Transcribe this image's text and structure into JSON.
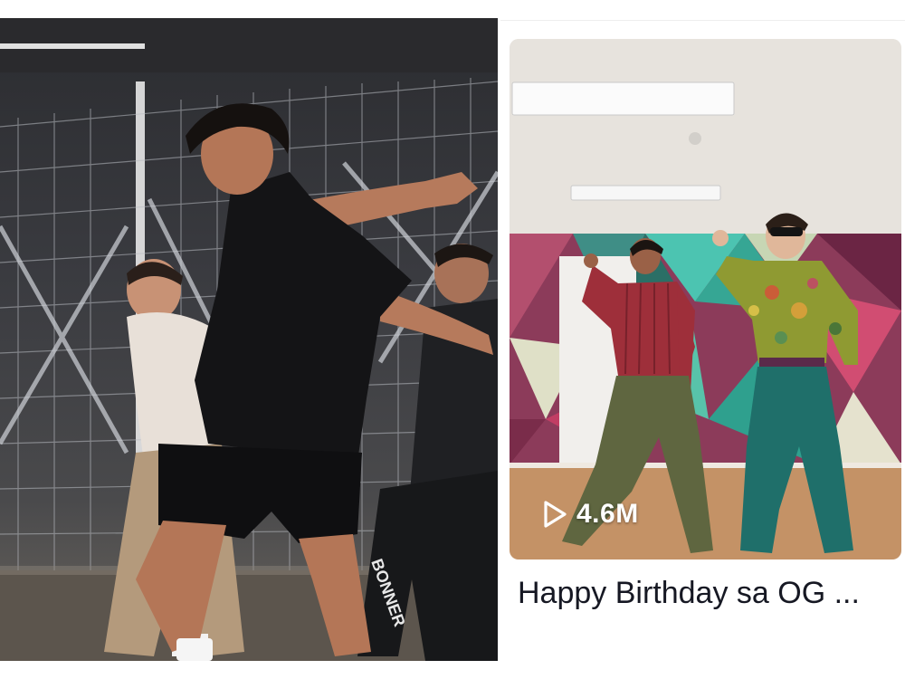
{
  "left_photo": {
    "caption": "",
    "pants_text": "BONNER"
  },
  "video_card": {
    "view_count": "4.6M",
    "play_icon": "play-icon",
    "title": "Happy Birthday sa OG ..."
  },
  "colors": {
    "title_text": "#161823",
    "overlay_text": "#ffffff"
  }
}
